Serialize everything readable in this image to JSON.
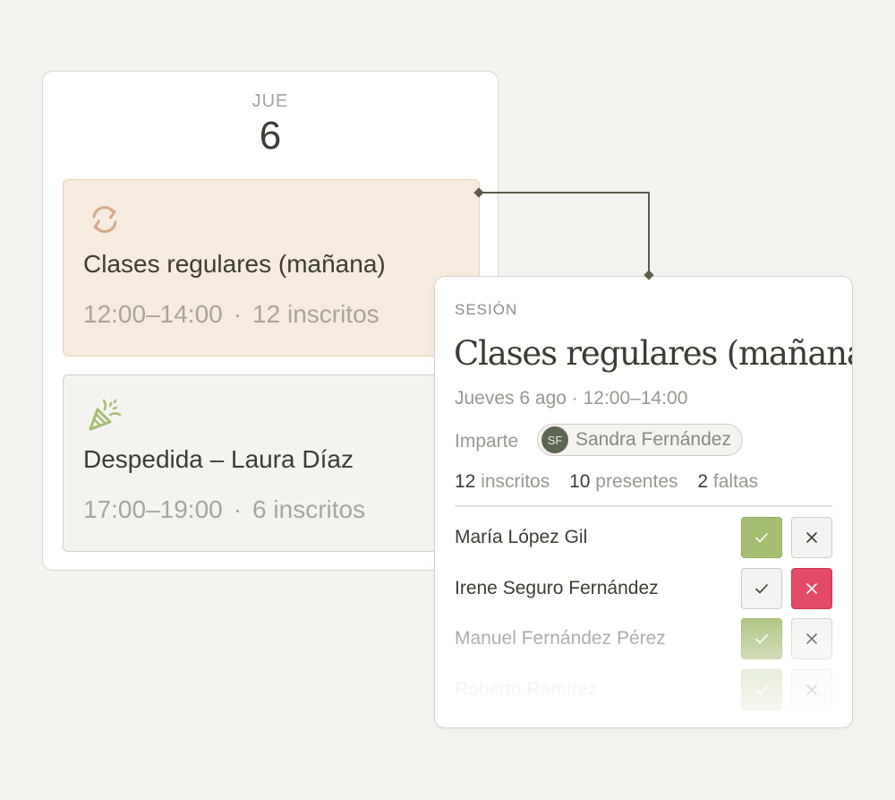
{
  "day": {
    "name": "JUE",
    "number": "6"
  },
  "events": [
    {
      "title": "Clases regulares (mañana)",
      "time": "12:00–14:00",
      "separator": "·",
      "enrolled": "12 inscritos",
      "icon": "repeat-icon",
      "accent": "#d6a98a"
    },
    {
      "title": "Despedida – Laura Díaz",
      "time": "17:00–19:00",
      "separator": "·",
      "enrolled": "6 inscritos",
      "icon": "party-popper-icon",
      "accent": "#a6be74"
    }
  ],
  "session": {
    "kicker": "SESIÓN",
    "title": "Clases regulares (mañana)",
    "datetime": "Jueves 6 ago · 12:00–14:00",
    "teacher_label": "Imparte",
    "teacher_initials": "SF",
    "teacher_name": "Sandra Fernández",
    "stats": {
      "enrolled_num": "12",
      "enrolled_label": "inscritos",
      "present_num": "10",
      "present_label": "presentes",
      "absent_num": "2",
      "absent_label": "faltas"
    },
    "attendees": [
      {
        "name": "María López Gil",
        "status": "present"
      },
      {
        "name": "Irene Seguro Fernández",
        "status": "absent"
      },
      {
        "name": "Manuel Fernández Pérez",
        "status": "present"
      },
      {
        "name": "Roberto Ramírez",
        "status": "present"
      }
    ]
  },
  "colors": {
    "present_green": "#a6be74",
    "absent_red": "#e24a66",
    "connector": "#5a5d4a",
    "regular_bg": "#f6ebde"
  }
}
